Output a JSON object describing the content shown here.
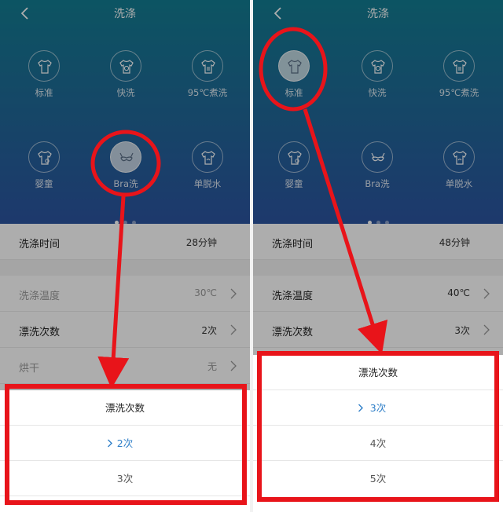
{
  "left": {
    "header": {
      "title": "洗涤"
    },
    "modes": [
      {
        "label": "标准",
        "icon": "shirt-icon"
      },
      {
        "label": "快洗",
        "icon": "fast-wash-shirt-icon"
      },
      {
        "label": "95℃煮洗",
        "icon": "boil-shirt-icon"
      },
      {
        "label": "婴童",
        "icon": "baby-clothes-icon"
      },
      {
        "label": "Bra洗",
        "icon": "bra-icon"
      },
      {
        "label": "单脱水",
        "icon": "spin-shirt-icon"
      }
    ],
    "selected_mode": "Bra洗",
    "settings": {
      "time": {
        "label": "洗涤时间",
        "value": "28分钟"
      },
      "temp": {
        "label": "洗涤温度",
        "value": "30℃"
      },
      "rinse": {
        "label": "漂洗次数",
        "value": "2次"
      },
      "dry": {
        "label": "烘干",
        "value": "无"
      }
    },
    "sheet": {
      "title": "漂洗次数",
      "options": [
        "2次",
        "3次"
      ],
      "selected": "2次"
    }
  },
  "right": {
    "header": {
      "title": "洗涤"
    },
    "modes": [
      {
        "label": "标准",
        "icon": "shirt-icon"
      },
      {
        "label": "快洗",
        "icon": "fast-wash-shirt-icon"
      },
      {
        "label": "95℃煮洗",
        "icon": "boil-shirt-icon"
      },
      {
        "label": "婴童",
        "icon": "baby-clothes-icon"
      },
      {
        "label": "Bra洗",
        "icon": "bra-icon"
      },
      {
        "label": "单脱水",
        "icon": "spin-shirt-icon"
      }
    ],
    "selected_mode": "标准",
    "settings": {
      "time": {
        "label": "洗涤时间",
        "value": "48分钟"
      },
      "temp": {
        "label": "洗涤温度",
        "value": "40℃"
      },
      "rinse": {
        "label": "漂洗次数",
        "value": "3次"
      }
    },
    "sheet": {
      "title": "漂洗次数",
      "options": [
        "3次",
        "4次",
        "5次"
      ],
      "selected": "3次"
    }
  },
  "page_indicator": {
    "count": 3,
    "active": 1
  },
  "colors": {
    "accent": "#2f7fc8",
    "annotation": "#e8141a",
    "hero_top": "#137d92",
    "hero_bottom": "#2c54a0"
  }
}
